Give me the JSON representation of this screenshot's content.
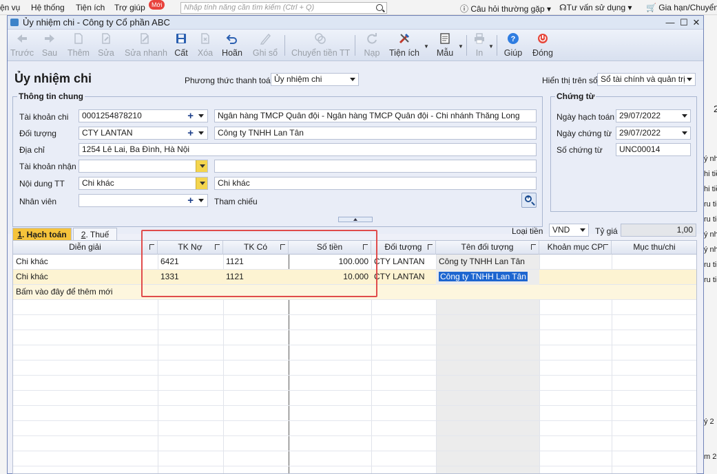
{
  "background_app": {
    "menu_items": [
      "ện vụ",
      "Hệ thống",
      "Tiện ích",
      "Trợ giúp"
    ],
    "new_badge": "Mới",
    "search_placeholder": "Nhập tính năng cần tìm kiếm (Ctrl + Q)",
    "faq": "Câu hỏi thường gặp",
    "support": "Tư vấn sử dụng",
    "renew": "Gia hạn/Chuyển",
    "right_fragments": [
      "2",
      "ý nhi",
      "hi tiề",
      "hi tiề",
      "ru tiề",
      "ru tiề",
      "ý nhi",
      "ý nhi",
      "ru tiề",
      "ru tiề",
      "ý 2",
      "m 20"
    ]
  },
  "window": {
    "title": "Ủy nhiệm chi - Công ty Cổ phần ABC"
  },
  "toolbar": {
    "back": "Trước",
    "next": "Sau",
    "add": "Thêm",
    "edit": "Sửa",
    "quick_edit": "Sửa nhanh",
    "save": "Cất",
    "delete": "Xóa",
    "undo": "Hoãn",
    "post": "Ghi sổ",
    "transfer": "Chuyển tiền TT",
    "reload": "Nạp",
    "utilities": "Tiện ích",
    "template": "Mẫu",
    "print": "In",
    "help": "Giúp",
    "close": "Đóng"
  },
  "form": {
    "heading": "Ủy nhiệm chi",
    "payment_method_label": "Phương thức thanh toán",
    "payment_method_value": "Ủy nhiệm chi",
    "display_on_label": "Hiển thị trên sổ",
    "display_on_value": "Sổ tài chính và quản trị",
    "general_info_title": "Thông tin chung",
    "account_label": "Tài khoản chi",
    "account_value": "0001254878210",
    "account_bank": "Ngân hàng TMCP Quân đội  - Ngân hàng TMCP Quân đội - Chi nhánh Thăng Long",
    "object_label": "Đối tượng",
    "object_value": "CTY LANTAN",
    "object_name": "Công ty TNHH Lan Tân",
    "address_label": "Địa chỉ",
    "address_value": "1254 Lê Lai, Ba Đình, Hà Nội",
    "recv_account_label": "Tài khoản nhận",
    "recv_account_value": "",
    "recv_bank_value": "",
    "content_label": "Nội dung TT",
    "content_value": "Chi khác",
    "content_text": "Chi khác",
    "staff_label": "Nhân viên",
    "staff_value": "",
    "reference_label": "Tham chiếu",
    "voucher_title": "Chứng từ",
    "posting_date_label": "Ngày hạch toán",
    "posting_date_value": "29/07/2022",
    "voucher_date_label": "Ngày chứng từ",
    "voucher_date_value": "29/07/2022",
    "voucher_no_label": "Số chứng từ",
    "voucher_no_value": "UNC00014",
    "currency_label": "Loại tiền",
    "currency_value": "VND",
    "rate_label": "Tỷ giá",
    "rate_value": "1,00"
  },
  "tabs": [
    {
      "num": "1",
      "label": ". Hạch toán"
    },
    {
      "num": "2",
      "label": ". Thuế"
    }
  ],
  "grid": {
    "columns": [
      "Diễn giải",
      "TK Nợ",
      "TK Có",
      "Số tiền",
      "Đối tượng",
      "Tên đối tượng",
      "Khoản mục CP",
      "Mục thu/chi"
    ],
    "rows": [
      {
        "desc": "Chi khác",
        "debit": "6421",
        "credit": "1121",
        "amount": "100.000",
        "object": "CTY LANTAN",
        "object_name": "Công ty TNHH Lan Tân"
      },
      {
        "desc": "Chi khác",
        "debit": "1331",
        "credit": "1121",
        "amount": "10.000",
        "object": "CTY LANTAN",
        "object_name": "Công ty TNHH Lan Tân"
      }
    ],
    "add_row_hint": "Bấm vào đây để thêm mới"
  }
}
